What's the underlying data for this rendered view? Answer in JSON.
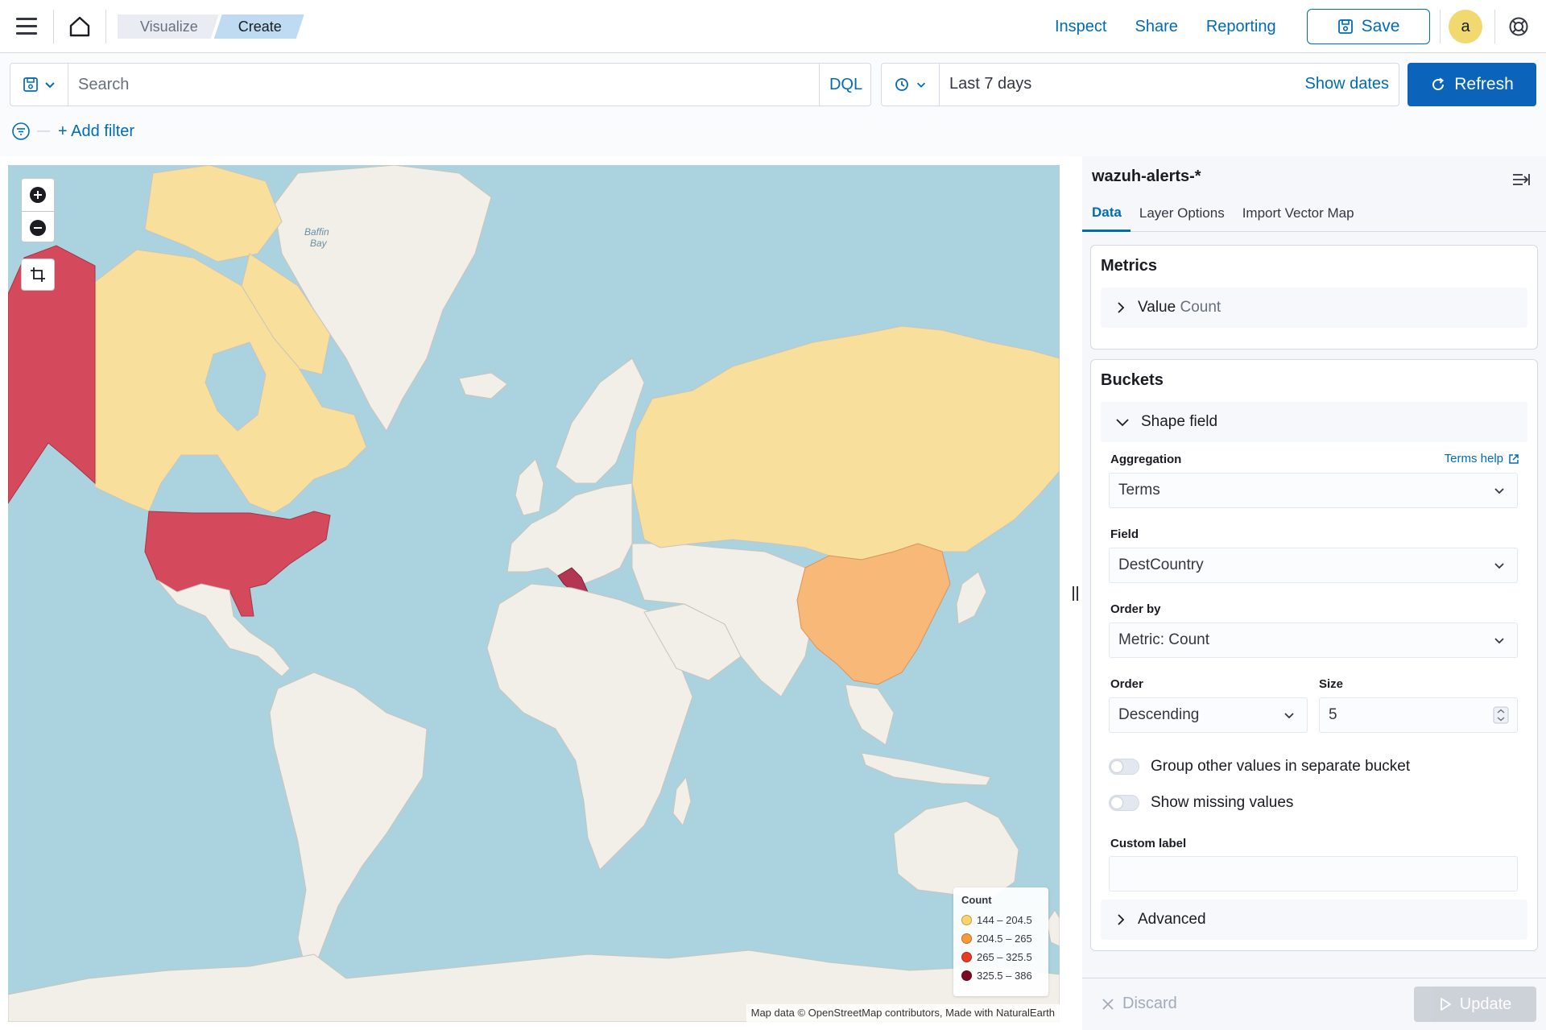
{
  "header": {
    "breadcrumbs": [
      "Visualize",
      "Create"
    ],
    "links": [
      "Inspect",
      "Share",
      "Reporting"
    ],
    "save_label": "Save",
    "avatar_initial": "a"
  },
  "query": {
    "search_placeholder": "Search",
    "language": "DQL",
    "date_range": "Last 7 days",
    "show_dates": "Show dates",
    "refresh_label": "Refresh",
    "add_filter": "+ Add filter"
  },
  "map": {
    "sea_label": [
      "Baffin",
      "Bay"
    ],
    "legend": {
      "title": "Count",
      "items": [
        {
          "label": "144 – 204.5",
          "color": "#fbd46c"
        },
        {
          "label": "204.5 – 265",
          "color": "#f99a38"
        },
        {
          "label": "265 – 325.5",
          "color": "#e53d22"
        },
        {
          "label": "325.5 – 386",
          "color": "#7a0a22"
        }
      ]
    },
    "attribution": "Map data © OpenStreetMap contributors, Made with NaturalEarth",
    "colors": {
      "ocean": "#aad3df",
      "land": "#f2efe9",
      "russia_canada": "#f9df9c",
      "china": "#f8b878",
      "usa": "#d44a5c",
      "italy": "#b33652"
    }
  },
  "panel": {
    "index_pattern": "wazuh-alerts-*",
    "tabs": [
      "Data",
      "Layer Options",
      "Import Vector Map"
    ],
    "metrics": {
      "title": "Metrics",
      "item_label": "Value",
      "item_sub": "Count"
    },
    "buckets": {
      "title": "Buckets",
      "item_label": "Shape field",
      "aggregation_label": "Aggregation",
      "aggregation_help": "Terms help",
      "aggregation_value": "Terms",
      "field_label": "Field",
      "field_value": "DestCountry",
      "order_by_label": "Order by",
      "order_by_value": "Metric: Count",
      "order_label": "Order",
      "order_value": "Descending",
      "size_label": "Size",
      "size_value": "5",
      "toggle_other": "Group other values in separate bucket",
      "toggle_missing": "Show missing values",
      "custom_label": "Custom label",
      "advanced": "Advanced"
    },
    "discard_label": "Discard",
    "update_label": "Update"
  }
}
